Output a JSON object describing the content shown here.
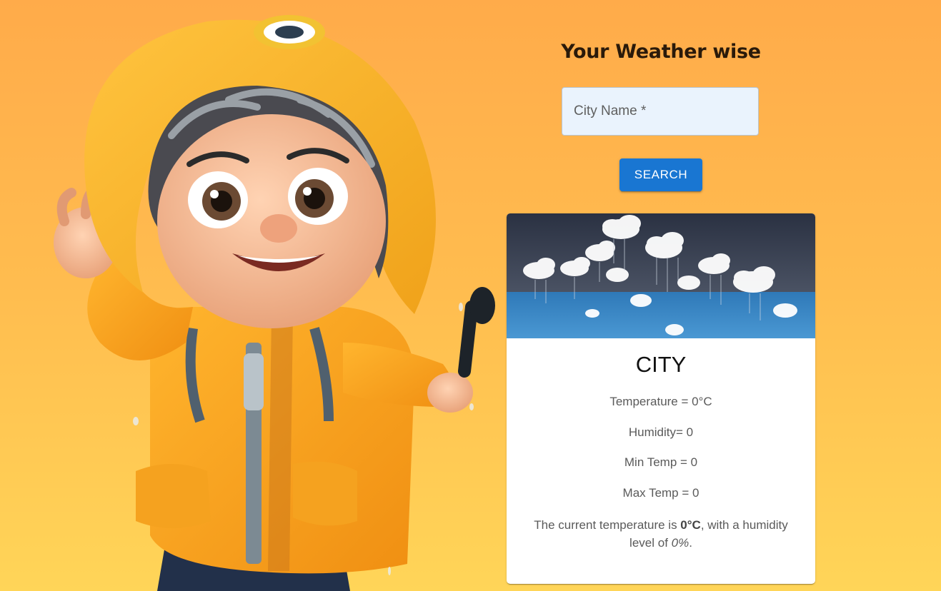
{
  "app": {
    "title": "Your Weather wise"
  },
  "search": {
    "placeholder": "City Name *",
    "value": "",
    "button_label": "SEARCH"
  },
  "card": {
    "city": "CITY",
    "temperature_line": "Temperature = 0°C",
    "humidity_line": "Humidity= 0",
    "min_temp_line": "Min Temp = 0",
    "max_temp_line": "Max Temp = 0",
    "summary": {
      "prefix": "The current temperature is ",
      "temp": "0°C",
      "middle": ", with a humidity level of ",
      "humidity": "0%",
      "suffix": "."
    }
  },
  "colors": {
    "background_top": "#ffab4a",
    "background_bottom": "#ffd558",
    "accent": "#1976d2",
    "input_background": "#eaf3fd",
    "title": "#2a1a0a"
  },
  "icons": {
    "mascot": "raincoat-kid-illustration",
    "card_media": "rain-clouds-illustration"
  }
}
